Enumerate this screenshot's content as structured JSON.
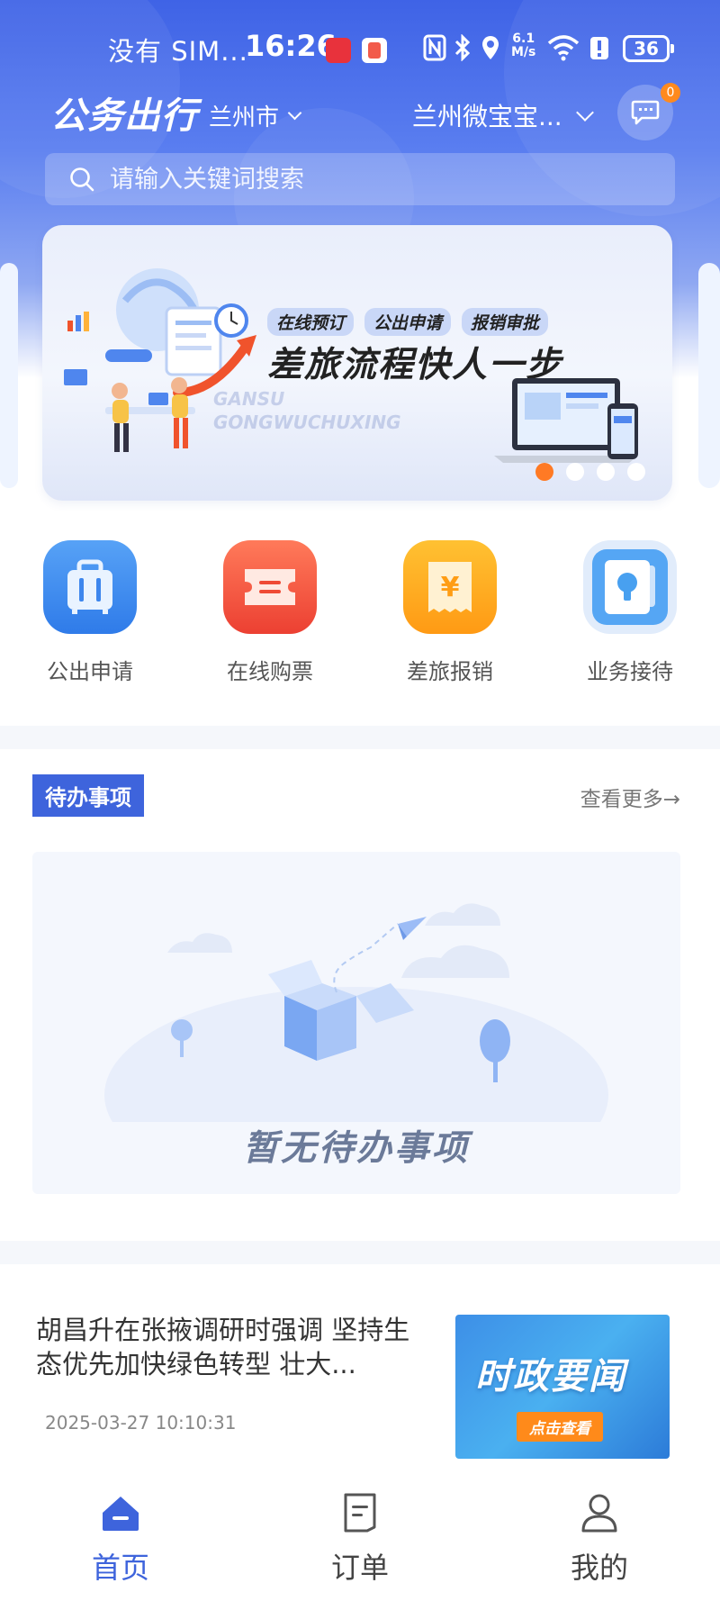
{
  "status_bar": {
    "carrier": "没有 SIM...",
    "time": "16:26",
    "network_speed_value": "6.1",
    "network_speed_unit": "M/s",
    "battery": "36"
  },
  "header": {
    "app_title": "公务出行",
    "city": "兰州市",
    "organization": "兰州微宝宝...",
    "message_count": "0"
  },
  "search": {
    "placeholder": "请输入关键词搜索"
  },
  "banner": {
    "tags": [
      "在线预订",
      "公出申请",
      "报销审批"
    ],
    "headline": "差旅流程快人一步",
    "watermark_line1": "GANSU",
    "watermark_line2": "GONGWUCHUXING",
    "slide_count": 4,
    "active_slide": 1
  },
  "quick_menu": {
    "items": [
      {
        "label": "公出申请",
        "icon": "suitcase-icon",
        "color": "#3f8ef0"
      },
      {
        "label": "在线购票",
        "icon": "ticket-icon",
        "color": "#f35a43"
      },
      {
        "label": "差旅报销",
        "icon": "receipt-yen-icon",
        "color": "#ffa41c"
      },
      {
        "label": "业务接待",
        "icon": "reception-card-icon",
        "color": "#48a0f0"
      }
    ]
  },
  "todo": {
    "title": "待办事项",
    "view_more": "查看更多→",
    "empty_text": "暂无待办事项"
  },
  "news": {
    "items": [
      {
        "title": "胡昌升在张掖调研时强调 坚持生态优先加快绿色转型 壮大...",
        "time": "2025-03-27 10:10:31",
        "thumb_title": "时政要闻",
        "thumb_button": "点击查看"
      }
    ]
  },
  "tab_bar": {
    "tabs": [
      {
        "label": "首页",
        "icon": "home-icon",
        "active": true
      },
      {
        "label": "订单",
        "icon": "order-icon",
        "active": false
      },
      {
        "label": "我的",
        "icon": "profile-icon",
        "active": false
      }
    ]
  },
  "colors": {
    "primary": "#3e64dc",
    "badge": "#ff8a1e",
    "active_dot": "#ff7a24"
  }
}
